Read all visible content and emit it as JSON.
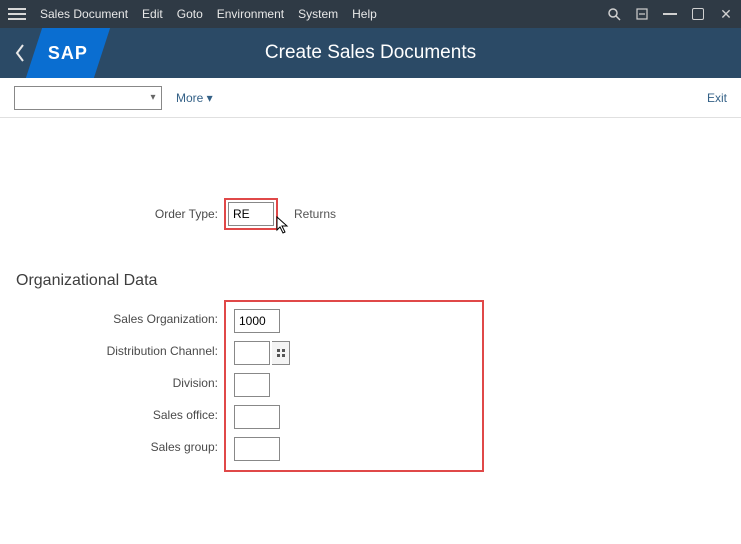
{
  "menubar": {
    "items": [
      "Sales Document",
      "Edit",
      "Goto",
      "Environment",
      "System",
      "Help"
    ]
  },
  "titlebar": {
    "logo": "SAP",
    "title": "Create Sales Documents"
  },
  "toolbar": {
    "combo_value": "",
    "more_label": "More ▾",
    "exit_label": "Exit"
  },
  "order_type": {
    "label": "Order Type:",
    "value": "RE",
    "desc": "Returns"
  },
  "org_section_title": "Organizational Data",
  "org": {
    "sales_org": {
      "label": "Sales Organization:",
      "value": "1000"
    },
    "dist_channel": {
      "label": "Distribution Channel:",
      "value": ""
    },
    "division": {
      "label": "Division:",
      "value": ""
    },
    "sales_office": {
      "label": "Sales office:",
      "value": ""
    },
    "sales_group": {
      "label": "Sales group:",
      "value": ""
    }
  }
}
